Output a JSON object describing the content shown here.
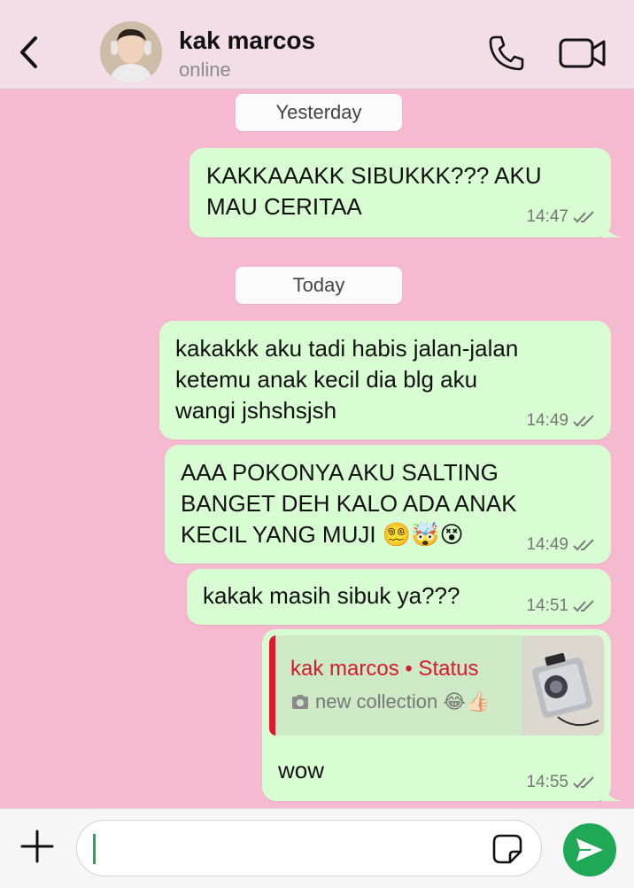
{
  "header": {
    "contact_name": "kak marcos",
    "contact_status": "online"
  },
  "dates": {
    "yesterday": "Yesterday",
    "today": "Today"
  },
  "messages": [
    {
      "text": "KAKKAAAKK SIBUKKK??? AKU\nMAU CERITAA",
      "time": "14:47"
    },
    {
      "text": "kakakkk aku tadi habis jalan-jalan\nketemu anak kecil dia blg aku\nwangi jshshsjsh",
      "time": "14:49"
    },
    {
      "text": "AAA POKONYA AKU SALTING\nBANGET DEH KALO ADA ANAK\nKECIL YANG MUJI 😵‍💫🤯😵",
      "time": "14:49"
    },
    {
      "text": "kakak masih sibuk ya???",
      "time": "14:51"
    },
    {
      "quote_author": "kak marcos • Status",
      "quote_caption": "new collection 😂👍🏻",
      "text": "wow",
      "time": "14:55"
    }
  ],
  "input": {
    "placeholder": ""
  },
  "colors": {
    "chat_background": "#f6bad0",
    "header_background": "#f3dde6",
    "outgoing_bubble": "#d9fdd3",
    "accent_green": "#1fa855",
    "quote_red": "#d61a2e"
  },
  "icons": [
    "back-icon",
    "phone-icon",
    "video-camera-icon",
    "double-check-icon",
    "camera-icon",
    "plus-icon",
    "sticker-icon",
    "send-icon"
  ]
}
